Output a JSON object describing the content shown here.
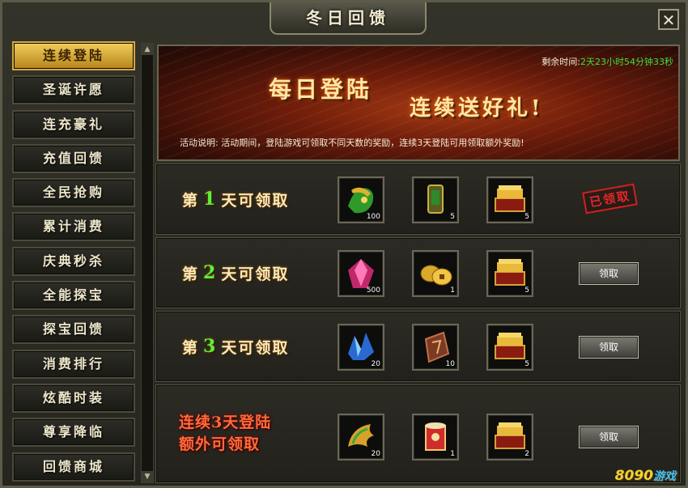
{
  "window": {
    "title": "冬日回馈",
    "close_label": "✕"
  },
  "sidebar": {
    "items": [
      {
        "label": "连续登陆",
        "active": true
      },
      {
        "label": "圣诞许愿",
        "active": false
      },
      {
        "label": "连充豪礼",
        "active": false
      },
      {
        "label": "充值回馈",
        "active": false
      },
      {
        "label": "全民抢购",
        "active": false
      },
      {
        "label": "累计消费",
        "active": false
      },
      {
        "label": "庆典秒杀",
        "active": false
      },
      {
        "label": "全能探宝",
        "active": false
      },
      {
        "label": "探宝回馈",
        "active": false
      },
      {
        "label": "消费排行",
        "active": false
      },
      {
        "label": "炫酷时装",
        "active": false
      },
      {
        "label": "尊享降临",
        "active": false
      },
      {
        "label": "回馈商城",
        "active": false
      }
    ]
  },
  "banner": {
    "timer_label": "剩余时间:",
    "timer_value": "2天23小时54分钟33秒",
    "headline_1": "每日登陆",
    "headline_2": "连续送好礼!",
    "description": "活动说明: 活动期间，登陆游戏可领取不同天数的奖励，连续3天登陆可用领取额外奖励!"
  },
  "rows": [
    {
      "prefix": "第",
      "num": "1",
      "suffix": "天可领取",
      "items": [
        {
          "icon": "green-gold-dragon-icon",
          "qty": "100"
        },
        {
          "icon": "jade-token-icon",
          "qty": "5"
        },
        {
          "icon": "gold-treasure-chest-icon",
          "qty": "5"
        }
      ],
      "status": "已领取"
    },
    {
      "prefix": "第",
      "num": "2",
      "suffix": "天可领取",
      "items": [
        {
          "icon": "pink-crystal-icon",
          "qty": "500"
        },
        {
          "icon": "gold-coin-icon",
          "qty": "1"
        },
        {
          "icon": "gold-treasure-chest-icon",
          "qty": "5"
        }
      ],
      "button": "领取"
    },
    {
      "prefix": "第",
      "num": "3",
      "suffix": "天可领取",
      "items": [
        {
          "icon": "blue-crystal-icon",
          "qty": "20"
        },
        {
          "icon": "rune-stone-icon",
          "qty": "10"
        },
        {
          "icon": "gold-treasure-chest-icon",
          "qty": "5"
        }
      ],
      "button": "领取"
    },
    {
      "label_line1": "连续3天登陆",
      "label_line2": "额外可领取",
      "items": [
        {
          "icon": "golden-wing-icon",
          "qty": "20"
        },
        {
          "icon": "scroll-icon",
          "qty": "1"
        },
        {
          "icon": "gold-treasure-chest-icon",
          "qty": "2"
        }
      ],
      "button": "领取"
    }
  ],
  "watermark": {
    "text": "8090",
    "suffix": "游戏"
  }
}
